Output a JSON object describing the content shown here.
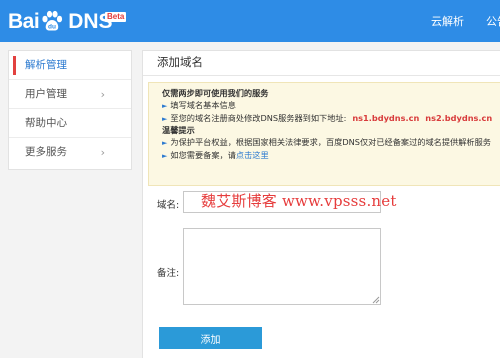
{
  "header": {
    "logo_part1": "Bai",
    "logo_part2": "DNS",
    "beta_badge": "Beta",
    "nav": [
      "云解析",
      "公告"
    ]
  },
  "sidebar": {
    "items": [
      {
        "label": "解析管理",
        "active": true,
        "expandable": false
      },
      {
        "label": "用户管理",
        "active": false,
        "expandable": true
      },
      {
        "label": "帮助中心",
        "active": false,
        "expandable": false
      },
      {
        "label": "更多服务",
        "active": false,
        "expandable": true
      }
    ]
  },
  "main": {
    "title": "添加域名",
    "notice": {
      "heading1": "仅需两步即可使用我们的服务",
      "step1": "填写域名基本信息",
      "step2": "至您的域名注册商处修改DNS服务器到如下地址:",
      "ns1": "ns1.bdydns.cn",
      "ns2": "ns2.bdydns.cn",
      "heading2": "温馨提示",
      "tip1": "为保护平台权益，根据国家相关法律要求，百度DNS仅对已经备案过的域名提供解析服务",
      "tip2_prefix": "如您需要备案，请",
      "tip2_link": "点击这里"
    },
    "form": {
      "domain_label": "域名:",
      "domain_placeholder": "",
      "note_label": "备注:",
      "submit_label": "添加"
    },
    "watermark": "魏艾斯博客  www.vpsss.net"
  },
  "colors": {
    "header_bg": "#2e8ce6",
    "active_bar": "#e2413f",
    "link": "#2e7bd0",
    "ns_red": "#d83b3b",
    "button_bg": "#2b9ad8",
    "notice_bg": "#fcf8e3"
  }
}
